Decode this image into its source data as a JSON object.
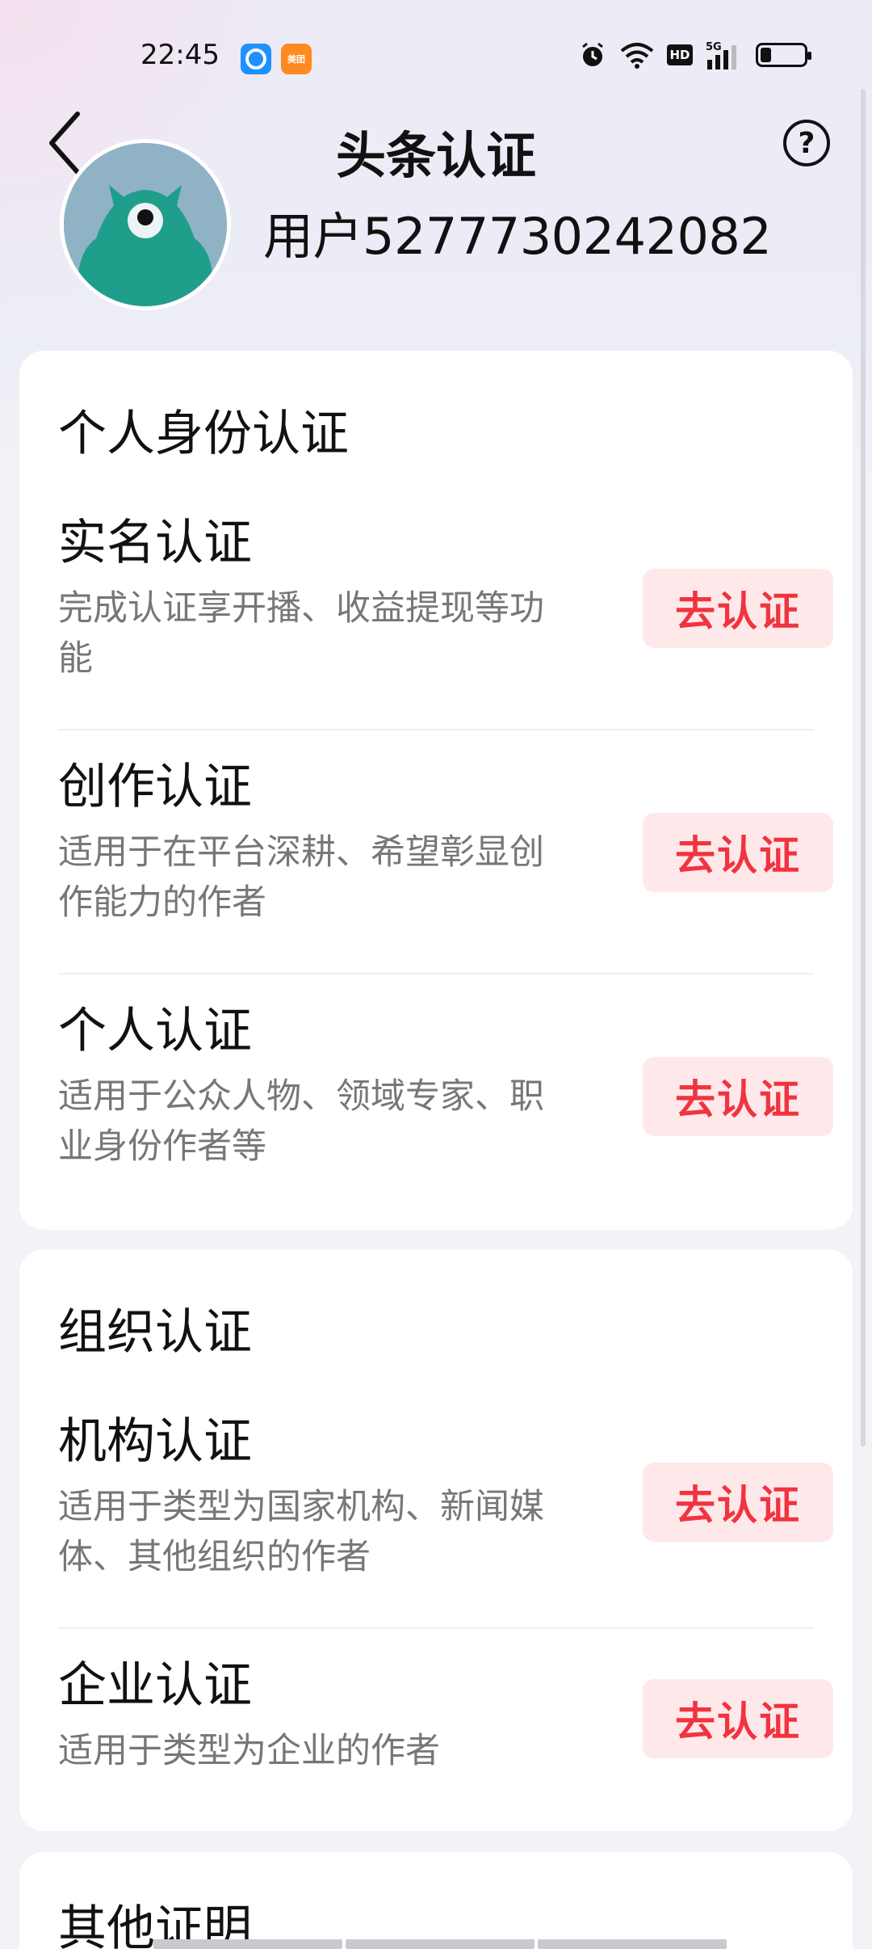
{
  "status_bar": {
    "time": "22:45",
    "app_icon_b_text": "美团",
    "network": "5G",
    "hd": "HD",
    "battery_level": 0.25
  },
  "header": {
    "title": "头条认证",
    "help_glyph": "?",
    "username": "用户5277730242082"
  },
  "cards": [
    {
      "title": "个人身份认证",
      "items": [
        {
          "title": "实名认证",
          "desc": "完成认证享开播、收益提现等功能",
          "button": "去认证"
        },
        {
          "title": "创作认证",
          "desc": "适用于在平台深耕、希望彰显创作能力的作者",
          "button": "去认证"
        },
        {
          "title": "个人认证",
          "desc": "适用于公众人物、领域专家、职业身份作者等",
          "button": "去认证"
        }
      ]
    },
    {
      "title": "组织认证",
      "items": [
        {
          "title": "机构认证",
          "desc": "适用于类型为国家机构、新闻媒体、其他组织的作者",
          "button": "去认证"
        },
        {
          "title": "企业认证",
          "desc": "适用于类型为企业的作者",
          "button": "去认证"
        }
      ]
    },
    {
      "title": "其他证明",
      "items": []
    }
  ],
  "colors": {
    "accent": "#f0343f",
    "button_bg": "#ffe8ea"
  }
}
